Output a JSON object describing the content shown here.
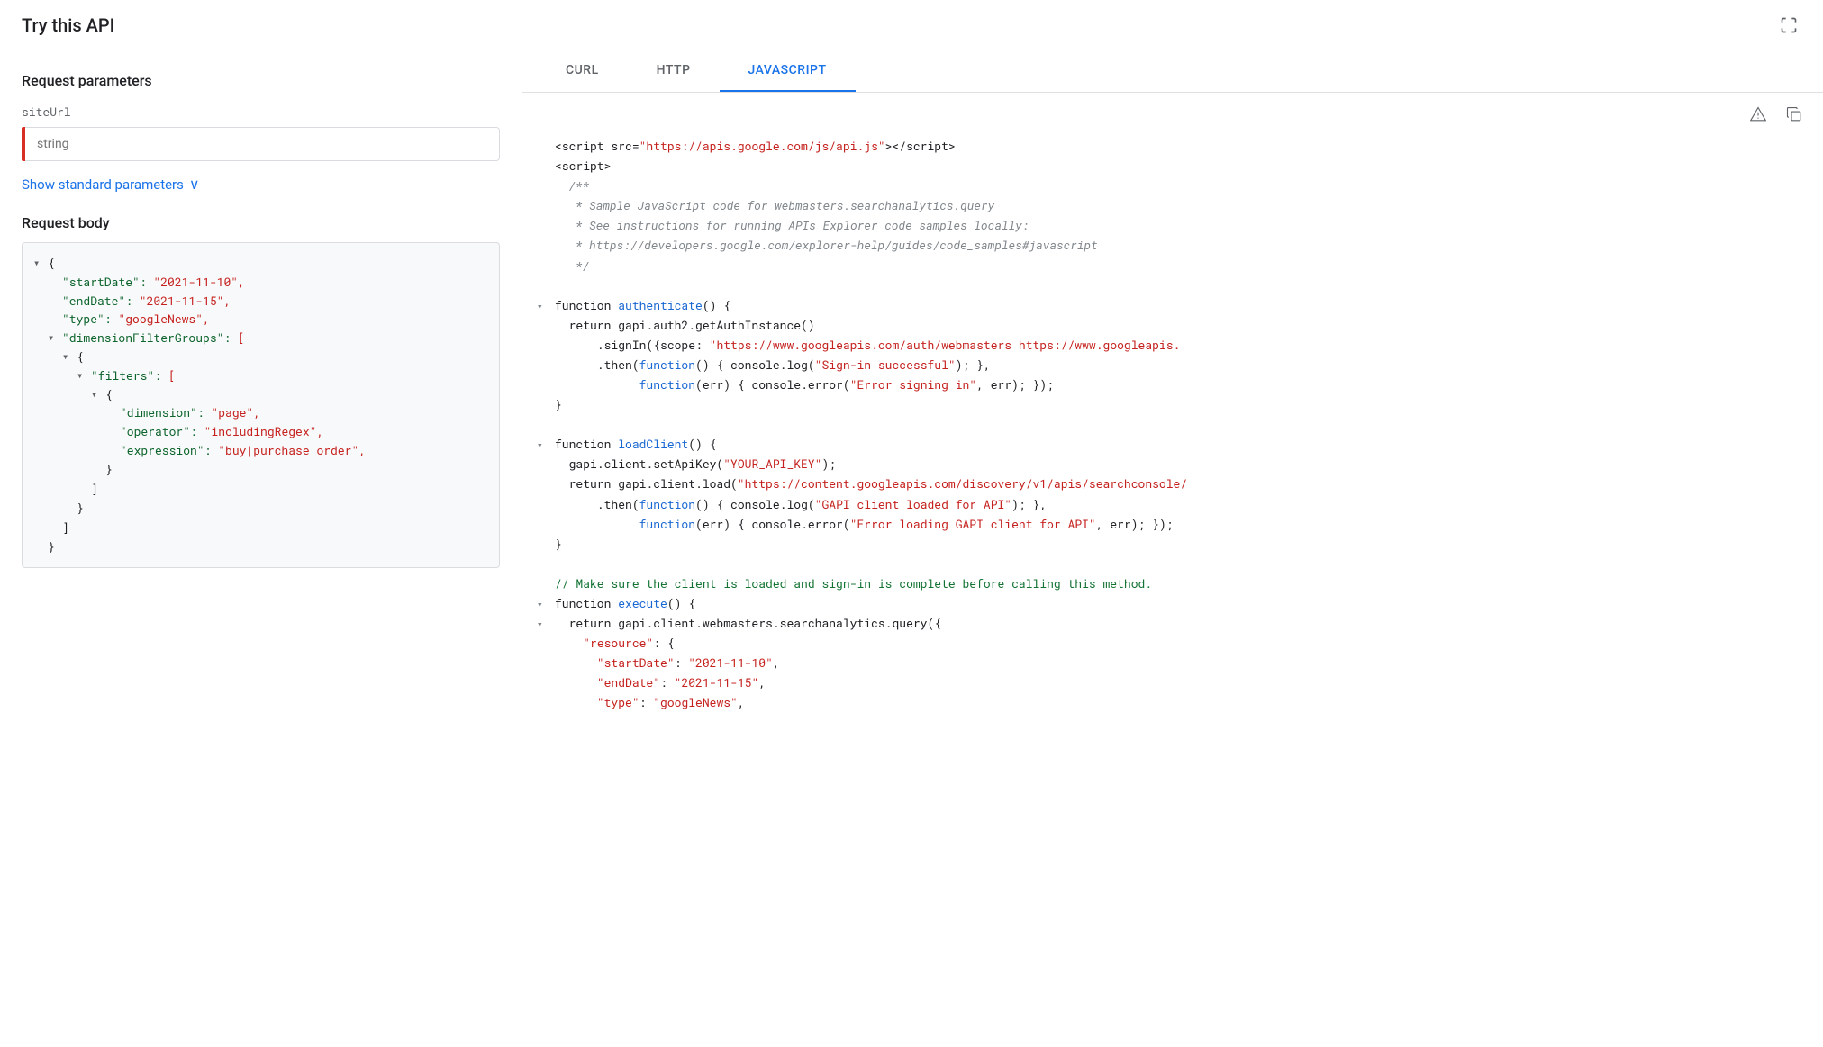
{
  "topBar": {
    "title": "Try this API",
    "expandIcon": "⤢"
  },
  "leftPanel": {
    "requestParams": {
      "title": "Request parameters",
      "paramLabel": "siteUrl",
      "inputPlaceholder": "string"
    },
    "showStandardParams": {
      "label": "Show standard parameters",
      "chevron": "∨"
    },
    "requestBody": {
      "title": "Request body",
      "jsonLines": [
        {
          "indent": 0,
          "toggle": "▾",
          "content": "{"
        },
        {
          "indent": 1,
          "toggle": "",
          "content": "\"startDate\": \"2021-11-10\","
        },
        {
          "indent": 1,
          "toggle": "",
          "content": "\"endDate\": \"2021-11-15\","
        },
        {
          "indent": 1,
          "toggle": "",
          "content": "\"type\": \"googleNews\","
        },
        {
          "indent": 1,
          "toggle": "▾",
          "content": "\"dimensionFilterGroups\": ["
        },
        {
          "indent": 2,
          "toggle": "▾",
          "content": "{"
        },
        {
          "indent": 3,
          "toggle": "▾",
          "content": "\"filters\": ["
        },
        {
          "indent": 4,
          "toggle": "▾",
          "content": "{"
        },
        {
          "indent": 5,
          "toggle": "",
          "content": "\"dimension\": \"page\","
        },
        {
          "indent": 5,
          "toggle": "",
          "content": "\"operator\": \"includingRegex\","
        },
        {
          "indent": 5,
          "toggle": "",
          "content": "\"expression\": \"buy|purchase|order\","
        },
        {
          "indent": 4,
          "toggle": "",
          "content": "}"
        },
        {
          "indent": 3,
          "toggle": "",
          "content": ""
        },
        {
          "indent": 3,
          "toggle": "",
          "content": "]"
        },
        {
          "indent": 2,
          "toggle": "",
          "content": ""
        },
        {
          "indent": 2,
          "toggle": "",
          "content": "}"
        },
        {
          "indent": 1,
          "toggle": "",
          "content": ""
        },
        {
          "indent": 1,
          "toggle": "",
          "content": "]"
        },
        {
          "indent": 0,
          "toggle": "",
          "content": "}"
        }
      ]
    }
  },
  "rightPanel": {
    "tabs": [
      {
        "label": "cURL",
        "active": false
      },
      {
        "label": "HTTP",
        "active": false
      },
      {
        "label": "JAVASCRIPT",
        "active": true
      }
    ],
    "toolbar": {
      "warningIcon": "⚠",
      "copyIcon": "⧉"
    },
    "codeLines": [
      {
        "toggle": "",
        "html": "<span class='js-plain'>&lt;script src=<span class='js-string-val'>\"https://apis.google.com/js/api.js\"</span>&gt;&lt;/script&gt;</span>"
      },
      {
        "toggle": "",
        "html": "<span class='js-plain'>&lt;script&gt;</span>"
      },
      {
        "toggle": "",
        "html": "<span class='js-comment'>  /**</span>"
      },
      {
        "toggle": "",
        "html": "<span class='js-comment'>   * Sample JavaScript code for webmasters.searchanalytics.query</span>"
      },
      {
        "toggle": "",
        "html": "<span class='js-comment'>   * See instructions for running APIs Explorer code samples locally:</span>"
      },
      {
        "toggle": "",
        "html": "<span class='js-comment'>   * https://developers.google.com/explorer-help/guides/code_samples#javascript</span>"
      },
      {
        "toggle": "",
        "html": "<span class='js-comment'>   */</span>"
      },
      {
        "toggle": "",
        "html": ""
      },
      {
        "toggle": "▾",
        "html": "<span class='js-keyword'>function </span><span class='js-func'>authenticate</span><span class='js-plain'>() {</span>"
      },
      {
        "toggle": "",
        "html": "<span class='js-plain'>  return gapi.auth2.getAuthInstance()</span>"
      },
      {
        "toggle": "",
        "html": "<span class='js-plain'>      .signIn({scope: <span class='js-string-val'>\"https://www.googleapis.com/auth/webmasters https://www.googleapis.</span></span>"
      },
      {
        "toggle": "",
        "html": "<span class='js-plain'>      .then(<span class='js-func'>function</span>() { console.log(<span class='js-string-val'>\"Sign-in successful\"</span>); },</span>"
      },
      {
        "toggle": "",
        "html": "<span class='js-plain'>            <span class='js-func'>function</span>(err) { console.error(<span class='js-string-val'>\"Error signing in\"</span>, err); });</span>"
      },
      {
        "toggle": "",
        "html": "<span class='js-plain'>}</span>"
      },
      {
        "toggle": "",
        "html": ""
      },
      {
        "toggle": "▾",
        "html": "<span class='js-keyword'>function </span><span class='js-func'>loadClient</span><span class='js-plain'>() {</span>"
      },
      {
        "toggle": "",
        "html": "<span class='js-plain'>  gapi.client.setApiKey(<span class='js-string-val'>\"YOUR_API_KEY\"</span>);</span>"
      },
      {
        "toggle": "",
        "html": "<span class='js-plain'>  return gapi.client.load(<span class='js-string-val'>\"https://content.googleapis.com/discovery/v1/apis/searchconsole/</span></span>"
      },
      {
        "toggle": "",
        "html": "<span class='js-plain'>      .then(<span class='js-func'>function</span>() { console.log(<span class='js-string-val'>\"GAPI client loaded for API\"</span>); },</span>"
      },
      {
        "toggle": "",
        "html": "<span class='js-plain'>            <span class='js-func'>function</span>(err) { console.error(<span class='js-string-val'>\"Error loading GAPI client for API\"</span>, err); });</span>"
      },
      {
        "toggle": "",
        "html": "<span class='js-plain'>}</span>"
      },
      {
        "toggle": "",
        "html": ""
      },
      {
        "toggle": "",
        "html": "<span class='js-green-comment'>// Make sure the client is loaded and sign-in is complete before calling this method.</span>"
      },
      {
        "toggle": "▾",
        "html": "<span class='js-keyword'>function </span><span class='js-func'>execute</span><span class='js-plain'>() {</span>"
      },
      {
        "toggle": "▾",
        "html": "<span class='js-plain'>  return gapi.client.webmasters.searchanalytics.query({</span>"
      },
      {
        "toggle": "",
        "html": "<span class='js-plain'>    <span class='js-string-val'>\"resource\"</span>: {</span>"
      },
      {
        "toggle": "",
        "html": "<span class='js-plain'>      <span class='js-string-val'>\"startDate\"</span>: <span class='js-string-val'>\"2021-11-10\"</span>,</span>"
      },
      {
        "toggle": "",
        "html": "<span class='js-plain'>      <span class='js-string-val'>\"endDate\"</span>: <span class='js-string-val'>\"2021-11-15\"</span>,</span>"
      },
      {
        "toggle": "",
        "html": "<span class='js-plain'>      <span class='js-string-val'>\"type\"</span>: <span class='js-string-val'>\"googleNews\"</span>,</span>"
      }
    ]
  }
}
